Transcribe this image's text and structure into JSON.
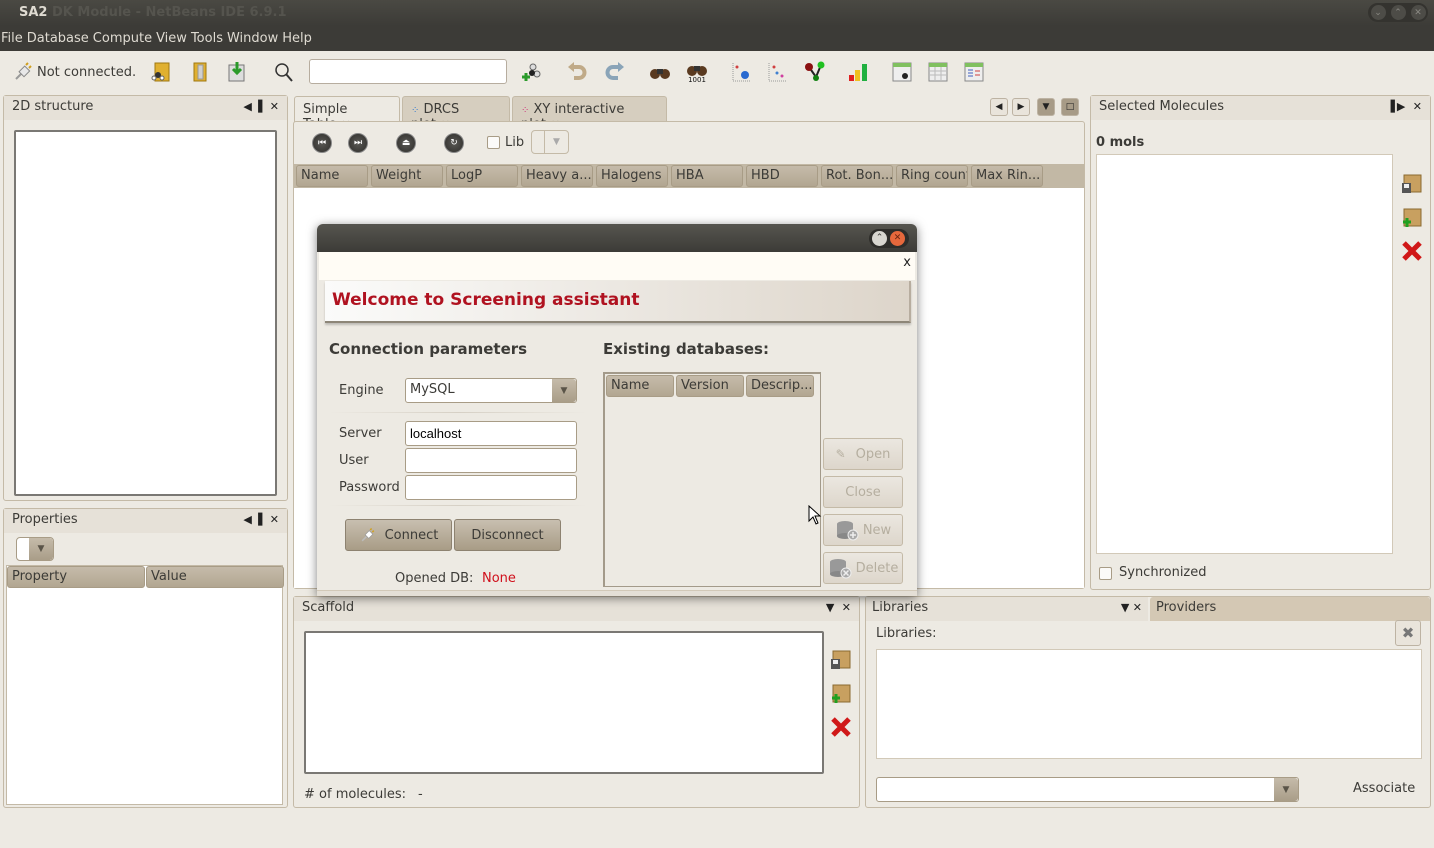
{
  "window": {
    "title": "SA2",
    "background_title": "DK Module - NetBeans IDE 6.9.1",
    "controls": [
      "minimize",
      "maximize",
      "close"
    ]
  },
  "menubar": {
    "items": [
      {
        "label": "File"
      },
      {
        "label": "Database"
      },
      {
        "label": "Compute"
      },
      {
        "label": "View"
      },
      {
        "label": "Tools"
      },
      {
        "label": "Window"
      },
      {
        "label": "Help"
      }
    ]
  },
  "toolbar": {
    "connection_status": "Not connected.",
    "search_value": "",
    "icons": [
      "plug-icon",
      "open-molecule-folder-icon",
      "open-folder-icon",
      "import-disk-icon",
      "search-icon",
      "add-molecule-icon",
      "undo-icon",
      "redo-icon",
      "binoculars-icon",
      "binoculars-1001-icon",
      "drcs-plot-icon",
      "xy-plot-icon",
      "graph-nodes-icon",
      "bar-chart-icon",
      "table-molecule-icon",
      "table-icon",
      "table-list-icon"
    ],
    "binoculars_badge": "1001"
  },
  "structure_panel": {
    "title": "2D structure"
  },
  "properties_panel": {
    "title": "Properties",
    "columns": [
      "Property",
      "Value"
    ],
    "rows": []
  },
  "editor": {
    "tabs": [
      {
        "label": "Simple Table",
        "active": true
      },
      {
        "label": "DRCS plot",
        "active": false
      },
      {
        "label": "XY interactive plot",
        "active": false
      }
    ],
    "table_toolbar": {
      "lib_label": "Lib",
      "lib_checked": false
    },
    "columns": [
      "Name",
      "Weight",
      "LogP",
      "Heavy a...",
      "Halogens",
      "HBA",
      "HBD",
      "Rot. Bon...",
      "Ring count",
      "Max Rin..."
    ],
    "rows": []
  },
  "selected_molecules": {
    "title": "Selected Molecules",
    "count_label": "0 mols",
    "synchronized_label": "Synchronized",
    "synchronized": false
  },
  "scaffold_panel": {
    "title": "Scaffold",
    "molecules_label": "# of molecules:",
    "molecules_value": "-"
  },
  "libraries_panel": {
    "tabs": [
      {
        "label": "Libraries",
        "active": true
      },
      {
        "label": "Providers",
        "active": false
      }
    ],
    "libraries_label": "Libraries:",
    "combo_value": "",
    "associate_label": "Associate"
  },
  "dialog": {
    "close_glyph": "x",
    "welcome_text": "Welcome to Screening assistant",
    "connection": {
      "title": "Connection parameters",
      "engine_label": "Engine",
      "engine_value": "MySQL",
      "server_label": "Server",
      "server_value": "localhost",
      "user_label": "User",
      "user_value": "",
      "password_label": "Password",
      "password_value": "",
      "connect_label": "Connect",
      "disconnect_label": "Disconnect",
      "opened_db_label": "Opened DB:",
      "opened_db_value": "None"
    },
    "databases": {
      "title": "Existing databases:",
      "columns": [
        "Name",
        "Version",
        "Descrip..."
      ],
      "rows": [],
      "buttons": {
        "open": "Open",
        "close": "Close",
        "new": "New",
        "delete": "Delete"
      }
    }
  },
  "colors": {
    "accent_red": "#b01220",
    "none_red": "#d0101c",
    "chrome_dark": "#3c3b37",
    "surface": "#edeae3"
  }
}
